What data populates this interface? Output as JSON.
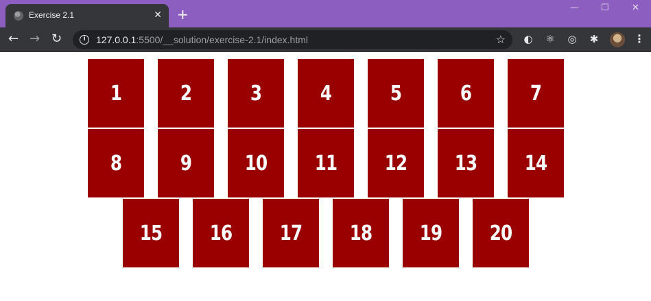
{
  "browser": {
    "tab_title": "Exercise 2.1",
    "tab_close": "✕",
    "new_tab": "+",
    "window_minimize": "—",
    "window_maximize": "☐",
    "window_close": "✕",
    "back": "←",
    "forward": "→",
    "reload": "↻",
    "url_host": "127.0.0.1",
    "url_rest": ":5500/__solution/exercise-2.1/index.html",
    "bookmark_star": "☆",
    "menu": "⋮",
    "extensions": [
      {
        "name": "extension-1-icon",
        "glyph": "◐"
      },
      {
        "name": "react-devtools-icon",
        "glyph": "⚛"
      },
      {
        "name": "target-icon",
        "glyph": "◎"
      },
      {
        "name": "puzzle-icon",
        "glyph": "✱"
      }
    ]
  },
  "page": {
    "box_color": "#990000",
    "boxes": [
      "1",
      "2",
      "3",
      "4",
      "5",
      "6",
      "7",
      "8",
      "9",
      "10",
      "11",
      "12",
      "13",
      "14",
      "15",
      "16",
      "17",
      "18",
      "19",
      "20"
    ]
  }
}
